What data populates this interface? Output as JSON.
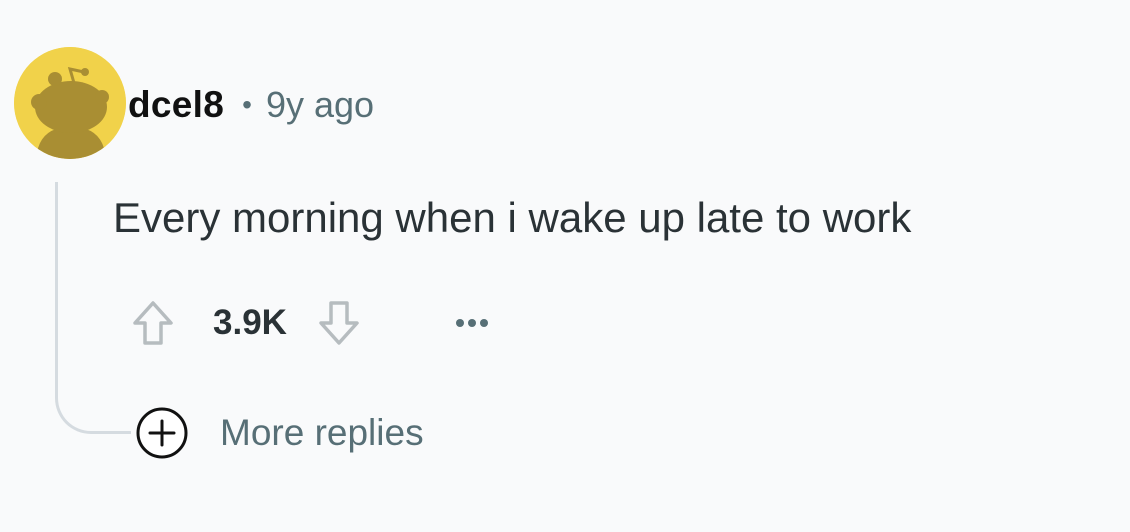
{
  "comment": {
    "username": "dcel8",
    "separator": "•",
    "timestamp": "9y ago",
    "body": "Every morning when i wake up late to work",
    "score": "3.9K",
    "more_replies_label": "More replies",
    "more_options_icon": "ellipsis-icon",
    "avatar_icon": "snoo-avatar-icon"
  },
  "colors": {
    "avatar_background": "#f1d24a",
    "snoo": "#a98e33",
    "meta_text": "#576f76",
    "thread_line": "#d5dbe0"
  }
}
